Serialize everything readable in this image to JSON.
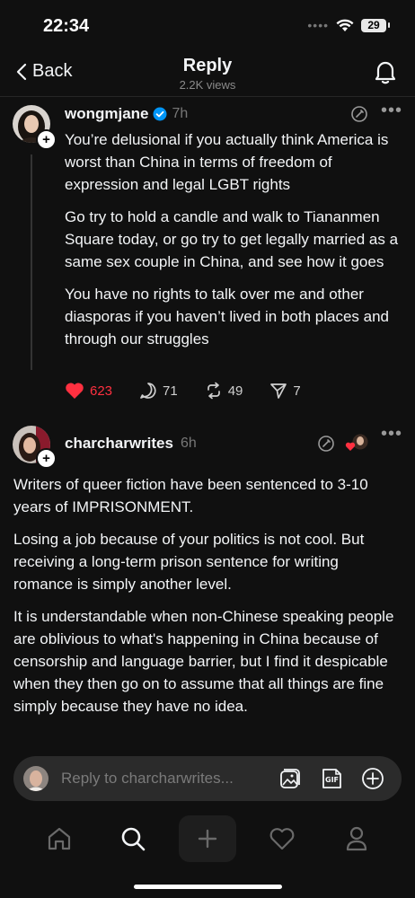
{
  "status_bar": {
    "time": "22:34",
    "battery": "29"
  },
  "nav": {
    "back_label": "Back",
    "title": "Reply",
    "views": "2.2K views"
  },
  "post1": {
    "username": "wongmjane",
    "time": "7h",
    "paragraphs": [
      "You’re delusional if you actually think America is worst than China in terms of freedom of expression and legal LGBT rights",
      "Go try to hold a candle and walk to Tiananmen Square today, or go try to get legally married as a same sex couple in China, and see how it goes",
      "You have no rights to talk over me and other diasporas if you haven’t lived in both places and through our struggles"
    ],
    "likes": "623",
    "replies": "71",
    "reposts": "49",
    "shares": "7"
  },
  "post2": {
    "username": "charcharwrites",
    "time": "6h",
    "paragraphs": [
      "Writers of queer fiction have been sentenced to 3-10 years of IMPRISONMENT.",
      "Losing a job because of your politics is not cool. But receiving a long-term prison sentence for writing romance is simply another level.",
      "It is understandable when non-Chinese speaking people are oblivious to what's happening in China because of censorship and language barrier, but I find it despicable when they then go on to assume that all things are fine simply because they have no idea."
    ]
  },
  "composer": {
    "placeholder": "Reply to charcharwrites..."
  },
  "colors": {
    "background": "#101010",
    "like_red": "#ff3040",
    "verified_blue": "#0095f6"
  }
}
